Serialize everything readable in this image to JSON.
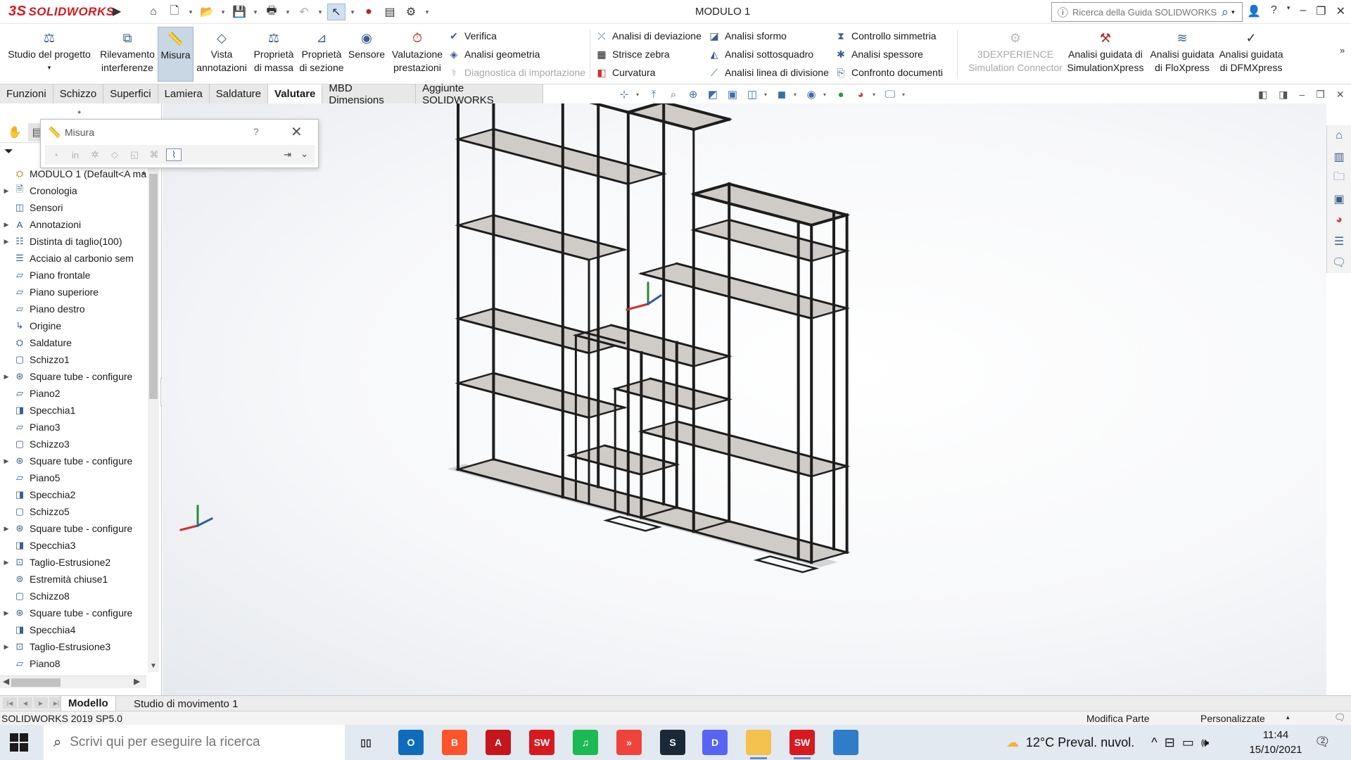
{
  "app": {
    "logo_text": "SOLIDWORKS",
    "document_title": "MODULO 1",
    "help_search_placeholder": "Ricerca della Guida SOLIDWORKS"
  },
  "ribbon": {
    "big_buttons": [
      {
        "id": "studio",
        "line1": "Studio del progetto",
        "line2": ""
      },
      {
        "id": "interf",
        "line1": "Rilevamento",
        "line2": "interferenze"
      },
      {
        "id": "misura",
        "line1": "Misura",
        "line2": "",
        "active": true
      },
      {
        "id": "vista",
        "line1": "Vista",
        "line2": "annotazioni"
      },
      {
        "id": "massa",
        "line1": "Proprietà",
        "line2": "di massa"
      },
      {
        "id": "sezione",
        "line1": "Proprietà",
        "line2": "di sezione"
      },
      {
        "id": "sensore",
        "line1": "Sensore",
        "line2": ""
      },
      {
        "id": "valprest",
        "line1": "Valutazione",
        "line2": "prestazioni"
      }
    ],
    "col1": [
      "Verifica",
      "Analisi geometria",
      "Diagnostica di importazione"
    ],
    "col2": [
      "Analisi di deviazione",
      "Strisce zebra",
      "Curvatura"
    ],
    "col3": [
      "Analisi sformo",
      "Analisi sottosquadro",
      "Analisi linea di divisione"
    ],
    "col4": [
      "Controllo simmetria",
      "Analisi spessore",
      "Confronto documenti"
    ],
    "right_buttons": [
      {
        "line1": "3DEXPERIENCE",
        "line2": "Simulation Connector",
        "disabled": true
      },
      {
        "line1": "Analisi guidata di",
        "line2": "SimulationXpress"
      },
      {
        "line1": "Analisi guidata",
        "line2": "di FloXpress"
      },
      {
        "line1": "Analisi guidata",
        "line2": "di DFMXpress"
      }
    ]
  },
  "tabs": [
    "Funzioni",
    "Schizzo",
    "Superfici",
    "Lamiera",
    "Saldature",
    "Valutare",
    "MBD Dimensions",
    "Aggiunte SOLIDWORKS"
  ],
  "active_tab": "Valutare",
  "measure_dialog": {
    "title": "Misura",
    "help": "?"
  },
  "feature_tree": [
    {
      "label": "MODULO 1  (Default<A ma",
      "icon": "part-icon",
      "expand": "up",
      "root": true
    },
    {
      "label": "Cronologia",
      "icon": "history-icon",
      "expand": "right"
    },
    {
      "label": "Sensori",
      "icon": "sensor-icon",
      "expand": ""
    },
    {
      "label": "Annotazioni",
      "icon": "annotation-icon",
      "expand": "right"
    },
    {
      "label": "Distinta di taglio(100)",
      "icon": "cutlist-icon",
      "expand": "right"
    },
    {
      "label": "Acciaio al carbonio sem",
      "icon": "material-icon",
      "expand": ""
    },
    {
      "label": "Piano frontale",
      "icon": "plane-icon",
      "expand": ""
    },
    {
      "label": "Piano superiore",
      "icon": "plane-icon",
      "expand": ""
    },
    {
      "label": "Piano destro",
      "icon": "plane-icon",
      "expand": ""
    },
    {
      "label": "Origine",
      "icon": "origin-icon",
      "expand": ""
    },
    {
      "label": "Saldature",
      "icon": "weldment-icon",
      "expand": ""
    },
    {
      "label": "Schizzo1",
      "icon": "sketch-icon",
      "expand": ""
    },
    {
      "label": "Square tube - configure",
      "icon": "structural-member-icon",
      "expand": "right"
    },
    {
      "label": "Piano2",
      "icon": "plane-icon",
      "expand": ""
    },
    {
      "label": "Specchia1",
      "icon": "mirror-icon",
      "expand": ""
    },
    {
      "label": "Piano3",
      "icon": "plane-icon",
      "expand": ""
    },
    {
      "label": "Schizzo3",
      "icon": "sketch-icon",
      "expand": ""
    },
    {
      "label": "Square tube - configure",
      "icon": "structural-member-icon",
      "expand": "right"
    },
    {
      "label": "Piano5",
      "icon": "plane-icon",
      "expand": ""
    },
    {
      "label": "Specchia2",
      "icon": "mirror-icon",
      "expand": ""
    },
    {
      "label": "Schizzo5",
      "icon": "sketch-icon",
      "expand": ""
    },
    {
      "label": "Square tube - configure",
      "icon": "structural-member-icon",
      "expand": "right"
    },
    {
      "label": "Specchia3",
      "icon": "mirror-icon",
      "expand": ""
    },
    {
      "label": "Taglio-Estrusione2",
      "icon": "cut-extrude-icon",
      "expand": "right"
    },
    {
      "label": "Estremità chiuse1",
      "icon": "end-cap-icon",
      "expand": ""
    },
    {
      "label": "Schizzo8",
      "icon": "sketch-icon",
      "expand": ""
    },
    {
      "label": "Square tube - configure",
      "icon": "structural-member-icon",
      "expand": "right"
    },
    {
      "label": "Specchia4",
      "icon": "mirror-icon",
      "expand": ""
    },
    {
      "label": "Taglio-Estrusione3",
      "icon": "cut-extrude-icon",
      "expand": "right"
    },
    {
      "label": "Piano8",
      "icon": "plane-icon",
      "expand": ""
    }
  ],
  "bottom_tabs": [
    "Modello",
    "Studio di movimento 1"
  ],
  "status": {
    "version": "SOLIDWORKS 2019 SP5.0",
    "mode": "Modifica Parte",
    "custom": "Personalizzate"
  },
  "taskbar": {
    "search_placeholder": "Scrivi qui per eseguire la ricerca",
    "weather": "12°C  Preval. nuvol.",
    "time": "11:44",
    "date": "15/10/2021",
    "notifications": "2",
    "apps": [
      {
        "name": "task-view",
        "label": "",
        "color": "transparent"
      },
      {
        "name": "outlook",
        "label": "O",
        "color": "#0f6cbd"
      },
      {
        "name": "brave",
        "label": "B",
        "color": "#fb542b"
      },
      {
        "name": "autocad",
        "label": "A",
        "color": "#c4161c"
      },
      {
        "name": "solidworks-2019",
        "label": "SW",
        "color": "#d71920"
      },
      {
        "name": "spotify",
        "label": "♫",
        "color": "#1db954"
      },
      {
        "name": "anydesk",
        "label": "»",
        "color": "#ef443b"
      },
      {
        "name": "steam",
        "label": "S",
        "color": "#1b2838"
      },
      {
        "name": "discord",
        "label": "D",
        "color": "#5865f2"
      },
      {
        "name": "file-explorer",
        "label": "",
        "color": "#f2c14e"
      },
      {
        "name": "solidworks-active",
        "label": "SW",
        "color": "#d71920"
      },
      {
        "name": "photos",
        "label": "",
        "color": "#2f7cc9"
      }
    ]
  }
}
